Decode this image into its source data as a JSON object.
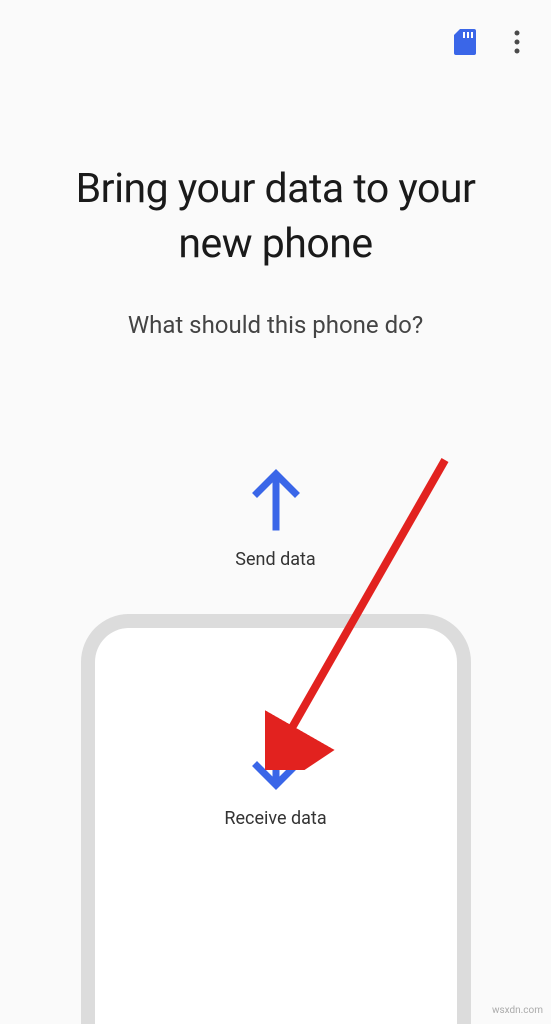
{
  "header": {
    "sd_icon": "sd-card",
    "menu_icon": "more-vert"
  },
  "title": "Bring your data to your new phone",
  "subtitle": "What should this phone do?",
  "send": {
    "label": "Send data"
  },
  "receive": {
    "label": "Receive data"
  },
  "colors": {
    "accent": "#3a66e8",
    "annotation": "#e2221f"
  },
  "watermark": "wsxdn.com"
}
